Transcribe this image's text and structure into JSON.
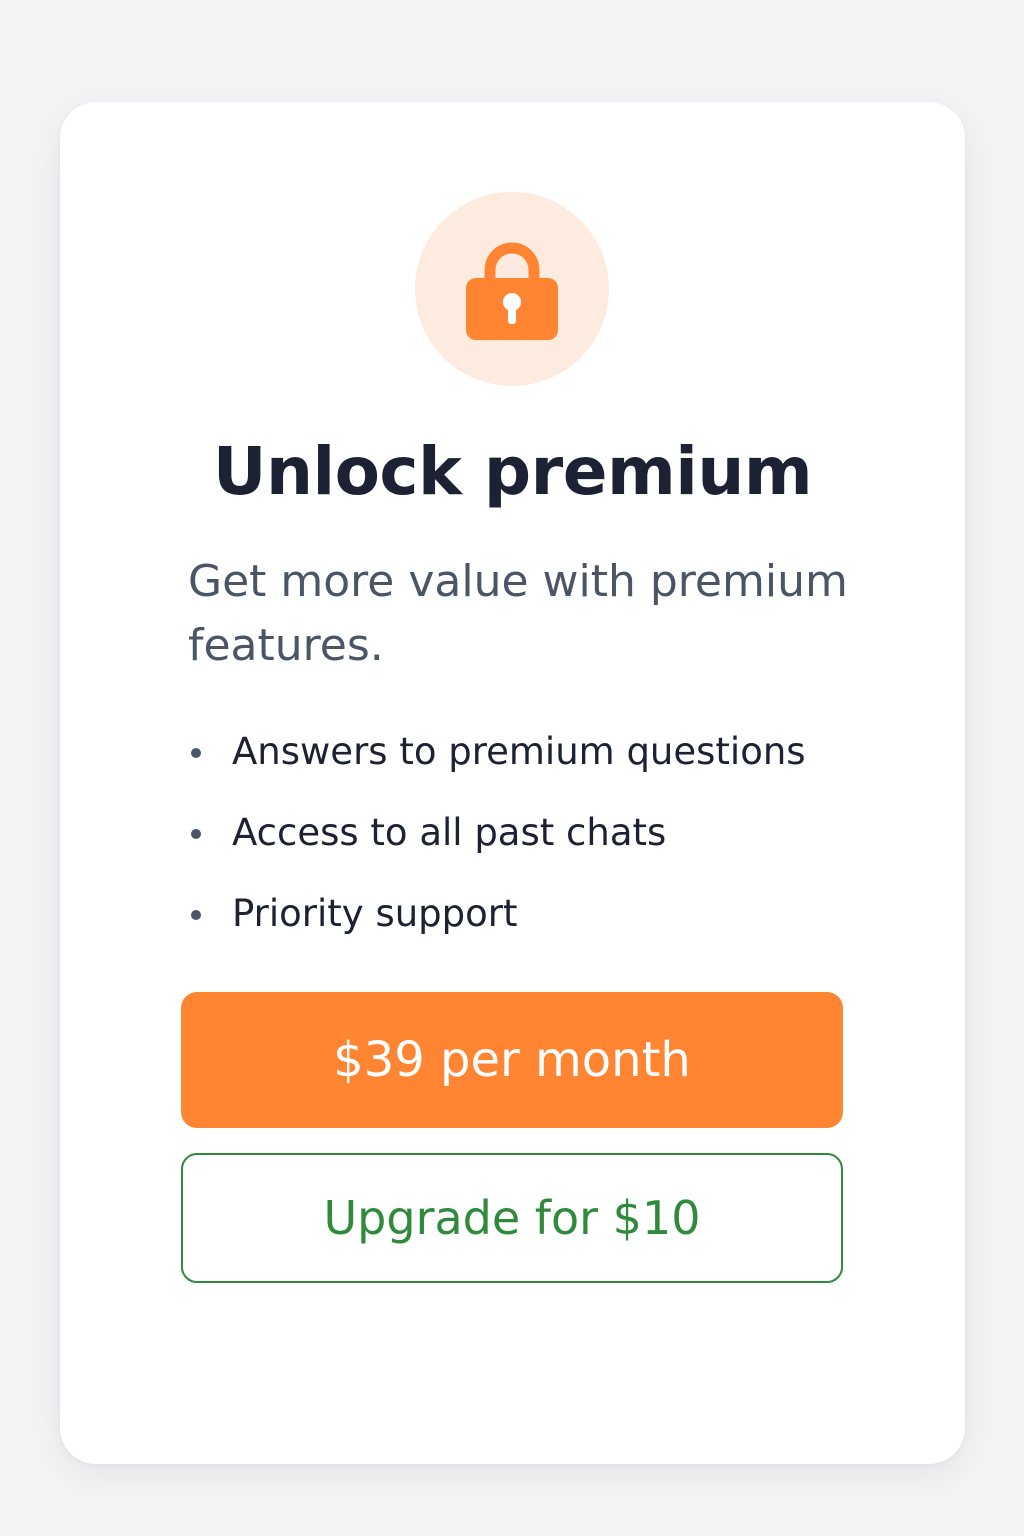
{
  "card": {
    "icon": "lock-icon",
    "title": "Unlock premium",
    "subtitle": "Get more value with premium features.",
    "features": [
      {
        "label": "Answers to premium questions"
      },
      {
        "label": "Access to all past chats"
      },
      {
        "label": "Priority support"
      }
    ],
    "primary_button": "$39 per month",
    "secondary_button": "Upgrade for $10"
  },
  "colors": {
    "accent": "#ff8533",
    "icon_background": "#fdebdf",
    "secondary_accent": "#2f8a3c",
    "title_text": "#1c2233",
    "body_text": "#4c5566"
  }
}
